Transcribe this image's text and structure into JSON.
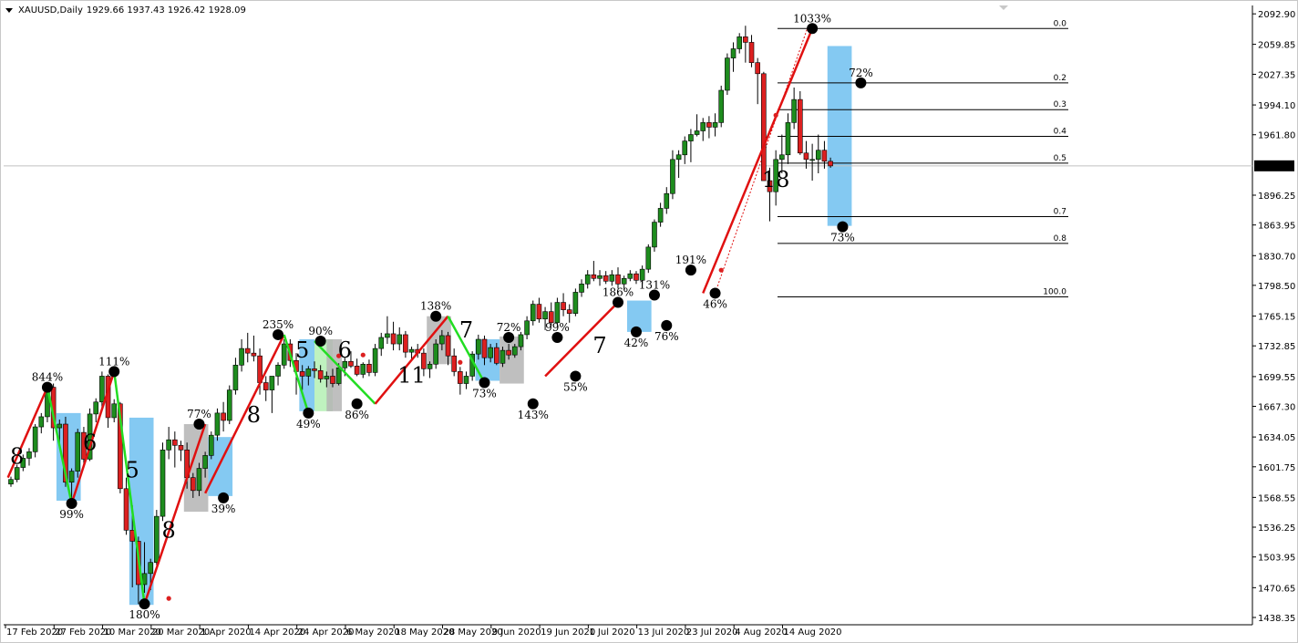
{
  "symbol_header": {
    "symbol_tf": "XAUUSD,Daily",
    "ohlc": "1929.66 1937.43 1926.42 1928.09"
  },
  "colors": {
    "bull": "#1e8c1e",
    "bear": "#dc2020",
    "wave_up": "#e01010",
    "wave_down": "#22dd22",
    "pivot": "#000000",
    "box_blue": "#6ebff0",
    "box_gray": "#b4b4b4",
    "box_green": "#b4f0b4",
    "fib_line": "#000000",
    "price_line": "#c0c0c0"
  },
  "chart_data": {
    "type": "candlestick",
    "instrument": "XAUUSD",
    "timeframe": "Daily",
    "ylim": [
      1438.35,
      2100
    ],
    "y_ticks": [
      "2092.90",
      "2059.85",
      "2027.35",
      "1994.10",
      "1961.80",
      "1928.09",
      "1896.25",
      "1863.95",
      "1830.70",
      "1798.50",
      "1765.15",
      "1732.85",
      "1699.55",
      "1667.30",
      "1634.05",
      "1601.75",
      "1568.55",
      "1536.25",
      "1503.95",
      "1470.65",
      "1438.35"
    ],
    "current_price": "1928.09",
    "x_ticks": [
      "17 Feb 2020",
      "27 Feb 2020",
      "10 Mar 2020",
      "20 Mar 2020",
      "1 Apr 2020",
      "14 Apr 2020",
      "24 Apr 2020",
      "6 May 2020",
      "18 May 2020",
      "28 May 2020",
      "9 Jun 2020",
      "19 Jun 2020",
      "1 Jul 2020",
      "13 Jul 2020",
      "23 Jul 2020",
      "4 Aug 2020",
      "14 Aug 2020"
    ],
    "x_tick_index": [
      0,
      8,
      16,
      24,
      32,
      40,
      48,
      56,
      64,
      72,
      80,
      88,
      96,
      104,
      112,
      120,
      128
    ],
    "candles": [
      [
        1583,
        1591,
        1580,
        1588
      ],
      [
        1588,
        1604,
        1585,
        1601
      ],
      [
        1601,
        1615,
        1597,
        1611
      ],
      [
        1611,
        1622,
        1603,
        1618
      ],
      [
        1618,
        1648,
        1612,
        1645
      ],
      [
        1645,
        1660,
        1638,
        1656
      ],
      [
        1656,
        1690,
        1650,
        1688
      ],
      [
        1688,
        1692,
        1630,
        1644
      ],
      [
        1644,
        1653,
        1623,
        1648
      ],
      [
        1648,
        1656,
        1580,
        1585
      ],
      [
        1585,
        1600,
        1562,
        1597
      ],
      [
        1597,
        1643,
        1590,
        1639
      ],
      [
        1639,
        1645,
        1603,
        1610
      ],
      [
        1610,
        1665,
        1608,
        1659
      ],
      [
        1659,
        1676,
        1650,
        1672
      ],
      [
        1672,
        1705,
        1665,
        1700
      ],
      [
        1700,
        1702,
        1644,
        1655
      ],
      [
        1655,
        1675,
        1650,
        1670
      ],
      [
        1670,
        1672,
        1573,
        1578
      ],
      [
        1578,
        1590,
        1528,
        1533
      ],
      [
        1533,
        1560,
        1471,
        1521
      ],
      [
        1521,
        1526,
        1453,
        1474
      ],
      [
        1474,
        1520,
        1465,
        1486
      ],
      [
        1486,
        1502,
        1468,
        1498
      ],
      [
        1498,
        1555,
        1495,
        1548
      ],
      [
        1548,
        1628,
        1543,
        1620
      ],
      [
        1620,
        1645,
        1610,
        1631
      ],
      [
        1631,
        1640,
        1601,
        1625
      ],
      [
        1625,
        1630,
        1608,
        1620
      ],
      [
        1620,
        1628,
        1578,
        1590
      ],
      [
        1590,
        1595,
        1568,
        1576
      ],
      [
        1576,
        1606,
        1570,
        1600
      ],
      [
        1600,
        1618,
        1590,
        1614
      ],
      [
        1614,
        1640,
        1610,
        1636
      ],
      [
        1636,
        1665,
        1630,
        1660
      ],
      [
        1660,
        1672,
        1640,
        1652
      ],
      [
        1652,
        1690,
        1648,
        1685
      ],
      [
        1685,
        1720,
        1680,
        1712
      ],
      [
        1712,
        1740,
        1705,
        1730
      ],
      [
        1730,
        1747,
        1715,
        1725
      ],
      [
        1725,
        1744,
        1716,
        1722
      ],
      [
        1722,
        1730,
        1680,
        1693
      ],
      [
        1693,
        1700,
        1673,
        1685
      ],
      [
        1685,
        1700,
        1660,
        1700
      ],
      [
        1700,
        1715,
        1690,
        1712
      ],
      [
        1712,
        1740,
        1708,
        1735
      ],
      [
        1735,
        1740,
        1710,
        1717
      ],
      [
        1717,
        1725,
        1680,
        1705
      ],
      [
        1705,
        1712,
        1685,
        1700
      ],
      [
        1700,
        1711,
        1690,
        1708
      ],
      [
        1708,
        1716,
        1698,
        1706
      ],
      [
        1706,
        1712,
        1693,
        1697
      ],
      [
        1697,
        1705,
        1688,
        1700
      ],
      [
        1700,
        1708,
        1688,
        1692
      ],
      [
        1692,
        1714,
        1690,
        1709
      ],
      [
        1709,
        1720,
        1700,
        1716
      ],
      [
        1716,
        1727,
        1709,
        1711
      ],
      [
        1711,
        1719,
        1700,
        1702
      ],
      [
        1702,
        1715,
        1698,
        1713
      ],
      [
        1713,
        1718,
        1700,
        1704
      ],
      [
        1704,
        1735,
        1700,
        1730
      ],
      [
        1730,
        1747,
        1722,
        1742
      ],
      [
        1742,
        1765,
        1735,
        1746
      ],
      [
        1746,
        1759,
        1728,
        1735
      ],
      [
        1735,
        1753,
        1728,
        1745
      ],
      [
        1745,
        1749,
        1720,
        1726
      ],
      [
        1726,
        1732,
        1718,
        1729
      ],
      [
        1729,
        1735,
        1720,
        1725
      ],
      [
        1725,
        1730,
        1700,
        1708
      ],
      [
        1708,
        1716,
        1698,
        1713
      ],
      [
        1713,
        1740,
        1708,
        1735
      ],
      [
        1735,
        1750,
        1728,
        1744
      ],
      [
        1744,
        1748,
        1712,
        1722
      ],
      [
        1722,
        1730,
        1700,
        1705
      ],
      [
        1705,
        1710,
        1680,
        1692
      ],
      [
        1692,
        1705,
        1686,
        1700
      ],
      [
        1700,
        1727,
        1695,
        1724
      ],
      [
        1724,
        1745,
        1718,
        1740
      ],
      [
        1740,
        1744,
        1712,
        1720
      ],
      [
        1720,
        1735,
        1715,
        1731
      ],
      [
        1731,
        1736,
        1712,
        1714
      ],
      [
        1714,
        1732,
        1710,
        1728
      ],
      [
        1728,
        1735,
        1718,
        1723
      ],
      [
        1723,
        1735,
        1720,
        1732
      ],
      [
        1732,
        1748,
        1728,
        1745
      ],
      [
        1745,
        1765,
        1740,
        1760
      ],
      [
        1760,
        1782,
        1755,
        1778
      ],
      [
        1778,
        1785,
        1758,
        1762
      ],
      [
        1762,
        1775,
        1750,
        1770
      ],
      [
        1770,
        1780,
        1755,
        1758
      ],
      [
        1758,
        1785,
        1755,
        1780
      ],
      [
        1780,
        1790,
        1765,
        1772
      ],
      [
        1772,
        1778,
        1758,
        1768
      ],
      [
        1768,
        1795,
        1765,
        1791
      ],
      [
        1791,
        1805,
        1786,
        1800
      ],
      [
        1800,
        1815,
        1795,
        1810
      ],
      [
        1810,
        1825,
        1803,
        1806
      ],
      [
        1806,
        1815,
        1798,
        1809
      ],
      [
        1809,
        1814,
        1800,
        1803
      ],
      [
        1803,
        1815,
        1798,
        1810
      ],
      [
        1810,
        1818,
        1795,
        1800
      ],
      [
        1800,
        1809,
        1793,
        1806
      ],
      [
        1806,
        1815,
        1803,
        1811
      ],
      [
        1811,
        1814,
        1800,
        1804
      ],
      [
        1804,
        1820,
        1800,
        1816
      ],
      [
        1816,
        1843,
        1812,
        1840
      ],
      [
        1840,
        1870,
        1835,
        1867
      ],
      [
        1867,
        1888,
        1862,
        1882
      ],
      [
        1882,
        1905,
        1876,
        1898
      ],
      [
        1898,
        1945,
        1892,
        1935
      ],
      [
        1935,
        1945,
        1915,
        1940
      ],
      [
        1940,
        1960,
        1930,
        1955
      ],
      [
        1955,
        1968,
        1932,
        1962
      ],
      [
        1962,
        1984,
        1960,
        1966
      ],
      [
        1966,
        1980,
        1955,
        1975
      ],
      [
        1975,
        1982,
        1958,
        1970
      ],
      [
        1970,
        1985,
        1960,
        1975
      ],
      [
        1975,
        2015,
        1970,
        2010
      ],
      [
        2010,
        2050,
        2005,
        2045
      ],
      [
        2045,
        2062,
        2030,
        2055
      ],
      [
        2055,
        2072,
        2050,
        2068
      ],
      [
        2068,
        2080,
        2040,
        2062
      ],
      [
        2062,
        2070,
        2035,
        2040
      ],
      [
        2040,
        2045,
        1995,
        2028
      ],
      [
        2028,
        2030,
        1935,
        1912
      ],
      [
        1912,
        1926,
        1868,
        1900
      ],
      [
        1900,
        1945,
        1885,
        1935
      ],
      [
        1935,
        1962,
        1920,
        1940
      ],
      [
        1940,
        1985,
        1930,
        1975
      ],
      [
        1975,
        2013,
        1968,
        2000
      ],
      [
        2000,
        2009,
        1940,
        1942
      ],
      [
        1942,
        1955,
        1925,
        1935
      ],
      [
        1935,
        1952,
        1912,
        1935
      ],
      [
        1935,
        1962,
        1920,
        1945
      ],
      [
        1945,
        1955,
        1925,
        1933
      ],
      [
        1933,
        1937,
        1926,
        1928
      ]
    ]
  },
  "fib_levels": [
    {
      "label": "0.0",
      "price": 2077
    },
    {
      "label": "0.2",
      "price": 2018
    },
    {
      "label": "0.3",
      "price": 1989
    },
    {
      "label": "0.4",
      "price": 1960
    },
    {
      "label": "0.5",
      "price": 1931
    },
    {
      "label": "0.7",
      "price": 1873
    },
    {
      "label": "0.8",
      "price": 1844
    },
    {
      "label": "100.0",
      "price": 1786
    }
  ],
  "wave_legs": [
    {
      "dir": "up",
      "from": [
        -0.5,
        1590
      ],
      "to": [
        6,
        1688
      ]
    },
    {
      "dir": "down",
      "from": [
        6,
        1688
      ],
      "to": [
        10,
        1562
      ]
    },
    {
      "dir": "up",
      "from": [
        10,
        1562
      ],
      "to": [
        17,
        1705
      ]
    },
    {
      "dir": "down",
      "from": [
        17,
        1705
      ],
      "to": [
        22,
        1453
      ]
    },
    {
      "dir": "up",
      "from": [
        22,
        1453
      ],
      "to": [
        32,
        1648
      ]
    },
    {
      "dir": "up",
      "from": [
        32,
        1573
      ],
      "to": [
        45,
        1745
      ]
    },
    {
      "dir": "down",
      "from": [
        45,
        1745
      ],
      "to": [
        49,
        1660
      ]
    },
    {
      "dir": "down",
      "from": [
        50,
        1738
      ],
      "to": [
        60,
        1670
      ]
    },
    {
      "dir": "up",
      "from": [
        60,
        1670
      ],
      "to": [
        72,
        1765
      ]
    },
    {
      "dir": "down",
      "from": [
        72,
        1765
      ],
      "to": [
        78,
        1693
      ]
    },
    {
      "dir": "up",
      "from": [
        88,
        1700
      ],
      "to": [
        100,
        1780
      ]
    },
    {
      "dir": "up",
      "from": [
        114,
        1790
      ],
      "to": [
        132,
        2077
      ]
    }
  ],
  "pivots": [
    {
      "i": 6,
      "p": 1688,
      "label": "844%",
      "pos": "above"
    },
    {
      "i": 10,
      "p": 1562,
      "label": "99%",
      "pos": "below"
    },
    {
      "i": 17,
      "p": 1705,
      "label": "111%",
      "pos": "above"
    },
    {
      "i": 22,
      "p": 1453,
      "label": "180%",
      "pos": "below"
    },
    {
      "i": 31,
      "p": 1648,
      "label": "77%",
      "pos": "above"
    },
    {
      "i": 35,
      "p": 1568,
      "label": "39%",
      "pos": "below"
    },
    {
      "i": 44,
      "p": 1745,
      "label": "235%",
      "pos": "above"
    },
    {
      "i": 49,
      "p": 1660,
      "label": "49%",
      "pos": "below"
    },
    {
      "i": 51,
      "p": 1738,
      "label": "90%",
      "pos": "above"
    },
    {
      "i": 57,
      "p": 1670,
      "label": "86%",
      "pos": "below"
    },
    {
      "i": 70,
      "p": 1765,
      "label": "138%",
      "pos": "above"
    },
    {
      "i": 78,
      "p": 1693,
      "label": "73%",
      "pos": "below"
    },
    {
      "i": 82,
      "p": 1742,
      "label": "72%",
      "pos": "above"
    },
    {
      "i": 86,
      "p": 1670,
      "label": "143%",
      "pos": "below"
    },
    {
      "i": 90,
      "p": 1742,
      "label": "99%",
      "pos": "above"
    },
    {
      "i": 93,
      "p": 1700,
      "label": "55%",
      "pos": "below"
    },
    {
      "i": 100,
      "p": 1780,
      "label": "186%",
      "pos": "above"
    },
    {
      "i": 103,
      "p": 1748,
      "label": "42%",
      "pos": "below"
    },
    {
      "i": 106,
      "p": 1788,
      "label": "131%",
      "pos": "above"
    },
    {
      "i": 108,
      "p": 1755,
      "label": "76%",
      "pos": "below"
    },
    {
      "i": 112,
      "p": 1815,
      "label": "191%",
      "pos": "above"
    },
    {
      "i": 116,
      "p": 1790,
      "label": "46%",
      "pos": "below"
    },
    {
      "i": 132,
      "p": 2077,
      "label": "1033%",
      "pos": "above"
    },
    {
      "i": 137,
      "p": 1862,
      "label": "73%",
      "pos": "below"
    },
    {
      "i": 140,
      "p": 2018,
      "label": "72%",
      "pos": "above"
    }
  ],
  "wave_numbers": [
    {
      "i": 1,
      "p": 1605,
      "t": "8"
    },
    {
      "i": 13,
      "p": 1620,
      "t": "6"
    },
    {
      "i": 20,
      "p": 1590,
      "t": "5"
    },
    {
      "i": 26,
      "p": 1525,
      "t": "8"
    },
    {
      "i": 40,
      "p": 1650,
      "t": "8"
    },
    {
      "i": 48,
      "p": 1720,
      "t": "5"
    },
    {
      "i": 55,
      "p": 1720,
      "t": "6"
    },
    {
      "i": 66,
      "p": 1693,
      "t": "11"
    },
    {
      "i": 75,
      "p": 1742,
      "t": "7"
    },
    {
      "i": 97,
      "p": 1725,
      "t": "7"
    },
    {
      "i": 126,
      "p": 1905,
      "t": "18"
    }
  ],
  "boxes": [
    {
      "i0": 7.5,
      "i1": 11.5,
      "top": 1660,
      "bot": 1565,
      "c": "blue"
    },
    {
      "i0": 19.5,
      "i1": 23.5,
      "top": 1655,
      "bot": 1452,
      "c": "blue"
    },
    {
      "i0": 28.5,
      "i1": 32.5,
      "top": 1648,
      "bot": 1553,
      "c": "gray"
    },
    {
      "i0": 32.5,
      "i1": 36.5,
      "top": 1634,
      "bot": 1570,
      "c": "blue"
    },
    {
      "i0": 47.5,
      "i1": 50,
      "top": 1740,
      "bot": 1662,
      "c": "blue"
    },
    {
      "i0": 50,
      "i1": 53,
      "top": 1740,
      "bot": 1662,
      "c": "green"
    },
    {
      "i0": 52,
      "i1": 54.5,
      "top": 1740,
      "bot": 1662,
      "c": "gray"
    },
    {
      "i0": 68.5,
      "i1": 72.5,
      "top": 1765,
      "bot": 1713,
      "c": "gray"
    },
    {
      "i0": 76.5,
      "i1": 80.5,
      "top": 1740,
      "bot": 1695,
      "c": "blue"
    },
    {
      "i0": 80.5,
      "i1": 84.5,
      "top": 1743,
      "bot": 1692,
      "c": "gray"
    },
    {
      "i0": 101.5,
      "i1": 105.5,
      "top": 1782,
      "bot": 1748,
      "c": "blue"
    },
    {
      "i0": 134.5,
      "i1": 138.5,
      "top": 2058,
      "bot": 1863,
      "c": "blue"
    }
  ],
  "red_dots": [
    {
      "i": 26,
      "p": 1459
    },
    {
      "i": 54,
      "p": 1722
    },
    {
      "i": 58,
      "p": 1723
    },
    {
      "i": 74,
      "p": 1715
    },
    {
      "i": 117,
      "p": 1815
    },
    {
      "i": 126,
      "p": 1983
    }
  ]
}
